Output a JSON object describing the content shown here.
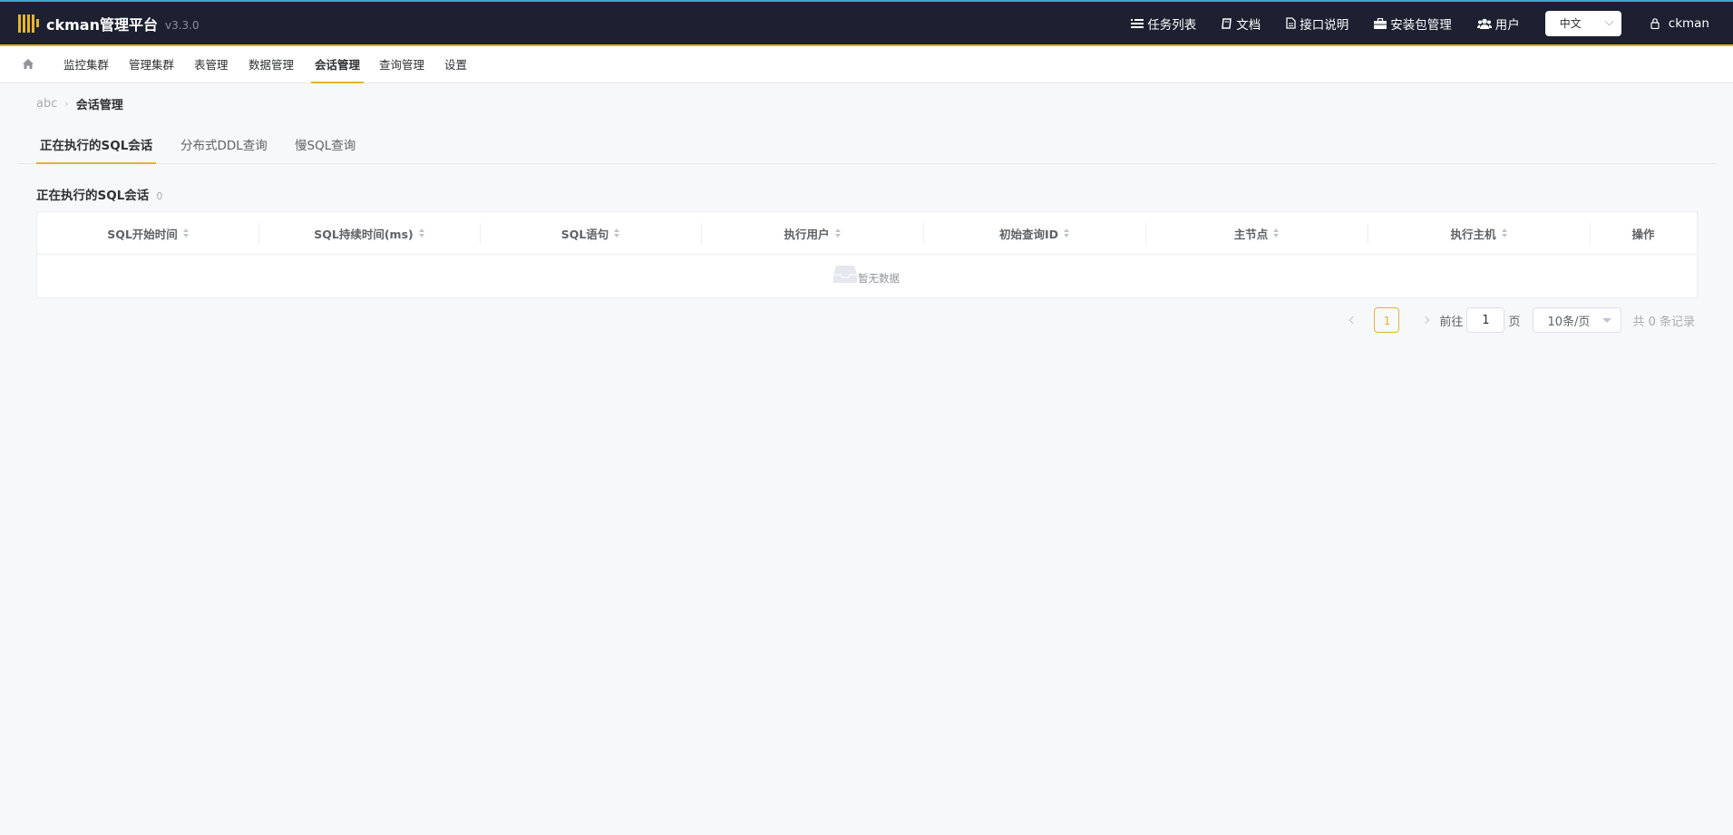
{
  "header": {
    "brand": "ckman管理平台",
    "version": "v3.3.0",
    "links": [
      {
        "label": "任务列表",
        "icon": "list-icon"
      },
      {
        "label": "文档",
        "icon": "book-icon"
      },
      {
        "label": "接口说明",
        "icon": "file-icon"
      },
      {
        "label": "安装包管理",
        "icon": "briefcase-icon"
      },
      {
        "label": "用户",
        "icon": "users-icon"
      }
    ],
    "language": "中文",
    "username": "ckman"
  },
  "subnav": {
    "items": [
      {
        "label": "监控集群"
      },
      {
        "label": "管理集群"
      },
      {
        "label": "表管理"
      },
      {
        "label": "数据管理"
      },
      {
        "label": "会话管理"
      },
      {
        "label": "查询管理"
      },
      {
        "label": "设置"
      }
    ],
    "active": "会话管理"
  },
  "breadcrumb": {
    "cluster": "abc",
    "separator": "›",
    "current": "会话管理"
  },
  "tabs": [
    {
      "label": "正在执行的SQL会话"
    },
    {
      "label": "分布式DDL查询"
    },
    {
      "label": "慢SQL查询"
    }
  ],
  "section": {
    "title": "正在执行的SQL会话",
    "count": "0"
  },
  "table": {
    "columns": [
      {
        "label": "SQL开始时间"
      },
      {
        "label": "SQL持续时间(ms)"
      },
      {
        "label": "SQL语句"
      },
      {
        "label": "执行用户"
      },
      {
        "label": "初始查询ID"
      },
      {
        "label": "主节点"
      },
      {
        "label": "执行主机"
      },
      {
        "label": "操作"
      }
    ],
    "rows": [],
    "empty_text": "暂无数据"
  },
  "pagination": {
    "current_page": "1",
    "goto_label": "前往",
    "goto_value": "1",
    "page_suffix": "页",
    "page_size": "10条/页",
    "total_text": "共 0 条记录"
  },
  "colors": {
    "header_bg": "#1c2030",
    "accent": "#e4b52a",
    "page_bg": "#f7f8fa"
  }
}
